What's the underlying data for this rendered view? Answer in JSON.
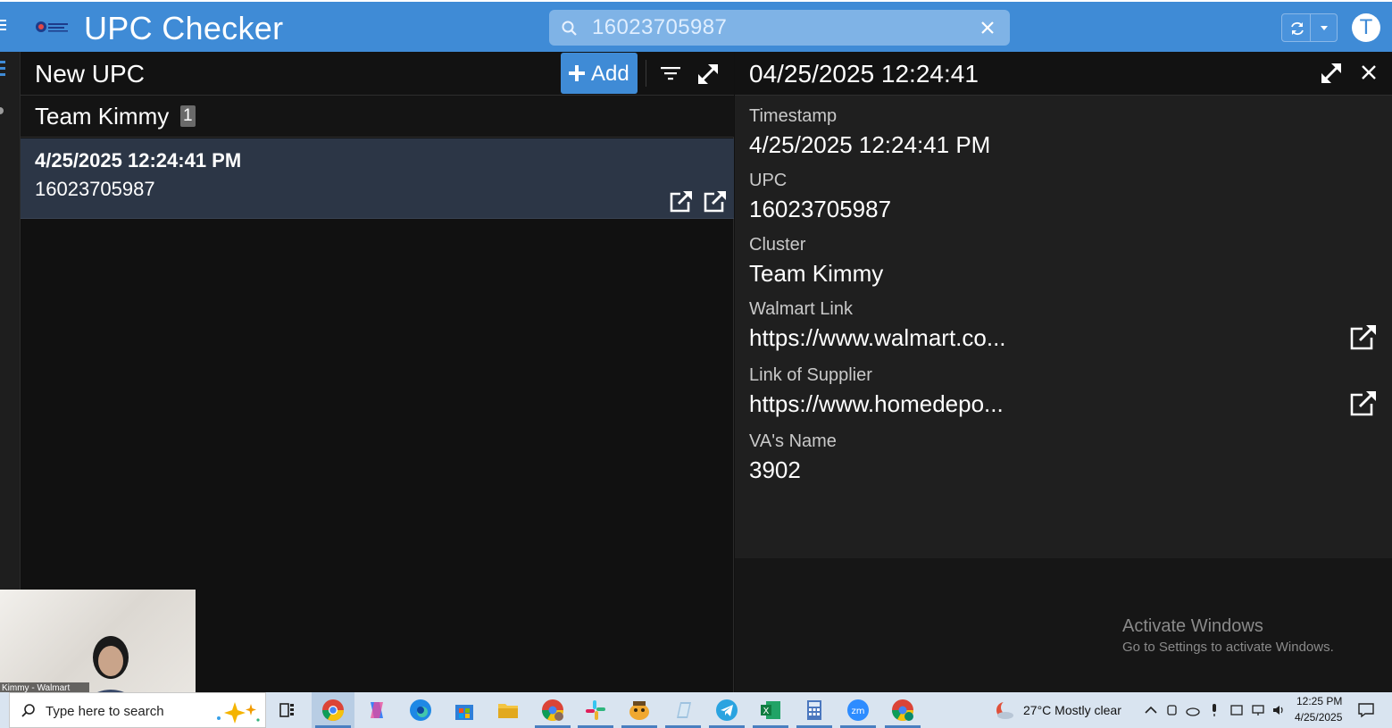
{
  "app": {
    "title": "UPC Checker",
    "search_value": "16023705987",
    "avatar_initial": "T",
    "accent_color": "#3f8bd6"
  },
  "list": {
    "title": "New UPC",
    "add_label": "Add",
    "group": {
      "title": "Team Kimmy",
      "count": "1"
    },
    "items": [
      {
        "timestamp": "4/25/2025 12:24:41 PM",
        "upc": "16023705987"
      }
    ]
  },
  "detail": {
    "title": "04/25/2025 12:24:41",
    "fields": [
      {
        "label": "Timestamp",
        "value": "4/25/2025 12:24:41 PM"
      },
      {
        "label": "UPC",
        "value": "16023705987"
      },
      {
        "label": "Cluster",
        "value": "Team Kimmy"
      },
      {
        "label": "Walmart Link",
        "value": "https://www.walmart.co..."
      },
      {
        "label": "Link of Supplier",
        "value": "https://www.homedepo..."
      },
      {
        "label": "VA's Name",
        "value": "3902"
      }
    ]
  },
  "watermark": {
    "title": "Activate Windows",
    "subtitle": "Go to Settings to activate Windows."
  },
  "webcam": {
    "name": "Kimmy - Walmart"
  },
  "taskbar": {
    "search_placeholder": "Type here to search",
    "weather": "27°C  Mostly clear",
    "time": "12:25 PM",
    "date": "4/25/2025",
    "apps": [
      "chrome-icon",
      "copilot-icon",
      "edge-icon",
      "store-icon",
      "file-explorer-icon",
      "chrome-profile-icon",
      "slack-icon",
      "game-icon",
      "notes-icon",
      "telegram-icon",
      "excel-icon",
      "calculator-icon",
      "zoom-icon",
      "chrome-t-icon"
    ]
  }
}
